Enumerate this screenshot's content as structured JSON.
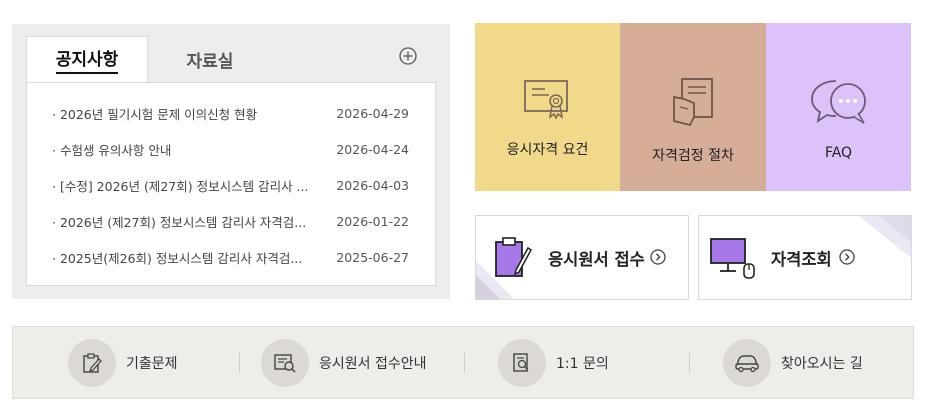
{
  "notice": {
    "tabs": [
      {
        "label": "공지사항"
      },
      {
        "label": "자료실"
      }
    ],
    "items": [
      {
        "title": "· 2026년 필기시험 문제 이의신청 현황",
        "date": "2026-04-29"
      },
      {
        "title": "· 수험생 유의사항 안내",
        "date": "2026-04-24"
      },
      {
        "title": "· [수정] 2026년 (제27회) 정보시스템 감리사 ...",
        "date": "2026-04-03"
      },
      {
        "title": "· 2026년 (제27회) 정보시스템 감리사 자격검...",
        "date": "2026-01-22"
      },
      {
        "title": "· 2025년(제26회) 정보시스템 감리사 자격검...",
        "date": "2025-06-27"
      }
    ]
  },
  "tiles": [
    {
      "label": "응시자격 요건",
      "icon": "certificate-icon",
      "color": "#f1d98b"
    },
    {
      "label": "자격검정 절차",
      "icon": "document-hand-icon",
      "color": "#d6ad98"
    },
    {
      "label": "FAQ",
      "icon": "chat-bubbles-icon",
      "color": "#dcc2f8"
    }
  ],
  "cards": [
    {
      "label": "응시원서 접수",
      "icon": "clipboard-pen-icon"
    },
    {
      "label": "자격조회",
      "icon": "monitor-mouse-icon"
    }
  ],
  "quick": [
    {
      "label": "기출문제",
      "icon": "clipboard-pencil-icon"
    },
    {
      "label": "응시원서 접수안내",
      "icon": "form-search-icon"
    },
    {
      "label": "1:1 문의",
      "icon": "document-search-icon"
    },
    {
      "label": "찾아오시는 길",
      "icon": "car-icon"
    }
  ],
  "colors": {
    "accent_purple": "#a678e8",
    "tile_yellow": "#f1d98b",
    "tile_brown": "#d6ad98",
    "tile_lavender": "#dcc2f8"
  }
}
